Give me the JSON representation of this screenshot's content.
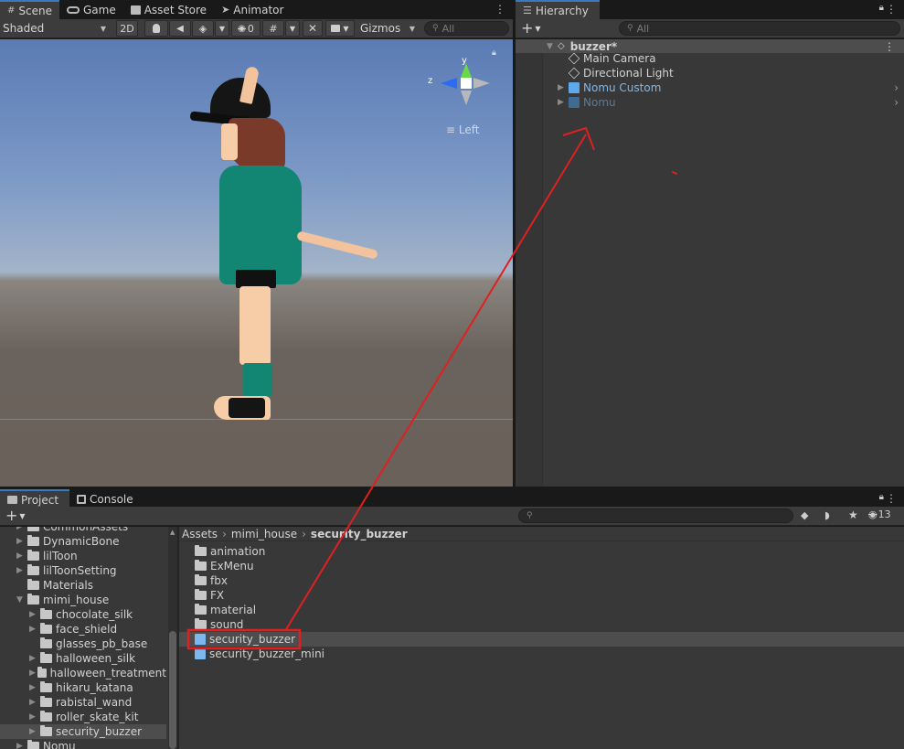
{
  "scene_tabs": [
    {
      "label": "Scene",
      "icon": "grid-icon"
    },
    {
      "label": "Game",
      "icon": "gamepad-icon"
    },
    {
      "label": "Asset Store",
      "icon": "store-icon"
    },
    {
      "label": "Animator",
      "icon": "animator-icon"
    }
  ],
  "scene_toolbar": {
    "shading_mode": "Shaded",
    "mode_2d": "2D",
    "hidden_count": "0",
    "gizmos_label": "Gizmos",
    "search_placeholder": "All"
  },
  "scene_view": {
    "gizmo_y": "y",
    "gizmo_z": "z",
    "view_label": "Left"
  },
  "hierarchy": {
    "tab_label": "Hierarchy",
    "search_placeholder": "All",
    "scene_name": "buzzer*",
    "items": [
      {
        "label": "Main Camera",
        "type": "object"
      },
      {
        "label": "Directional Light",
        "type": "object"
      },
      {
        "label": "Nomu Custom",
        "type": "prefab"
      },
      {
        "label": "Nomu",
        "type": "prefab-disabled"
      }
    ]
  },
  "project_tabs": [
    {
      "label": "Project",
      "icon": "folder-icon"
    },
    {
      "label": "Console",
      "icon": "console-icon"
    }
  ],
  "project_toolbar": {
    "hidden_count": "13"
  },
  "breadcrumb": [
    "Assets",
    "mimi_house",
    "security_buzzer"
  ],
  "folder_tree": [
    {
      "label": "CommonAssets",
      "indent": 0,
      "arrow": "right"
    },
    {
      "label": "DynamicBone",
      "indent": 0,
      "arrow": "right"
    },
    {
      "label": "lilToon",
      "indent": 0,
      "arrow": "right"
    },
    {
      "label": "lilToonSetting",
      "indent": 0,
      "arrow": "right"
    },
    {
      "label": "Materials",
      "indent": 0,
      "arrow": ""
    },
    {
      "label": "mimi_house",
      "indent": 0,
      "arrow": "down"
    },
    {
      "label": "chocolate_silk",
      "indent": 1,
      "arrow": "right"
    },
    {
      "label": "face_shield",
      "indent": 1,
      "arrow": "right"
    },
    {
      "label": "glasses_pb_base",
      "indent": 1,
      "arrow": ""
    },
    {
      "label": "halloween_silk",
      "indent": 1,
      "arrow": "right"
    },
    {
      "label": "halloween_treatment",
      "indent": 1,
      "arrow": "right"
    },
    {
      "label": "hikaru_katana",
      "indent": 1,
      "arrow": "right"
    },
    {
      "label": "rabistal_wand",
      "indent": 1,
      "arrow": "right"
    },
    {
      "label": "roller_skate_kit",
      "indent": 1,
      "arrow": "right"
    },
    {
      "label": "security_buzzer",
      "indent": 1,
      "arrow": "right",
      "selected": true
    },
    {
      "label": "Nomu",
      "indent": 0,
      "arrow": "right"
    }
  ],
  "asset_list": [
    {
      "label": "animation",
      "type": "folder"
    },
    {
      "label": "ExMenu",
      "type": "folder"
    },
    {
      "label": "fbx",
      "type": "folder"
    },
    {
      "label": "FX",
      "type": "folder"
    },
    {
      "label": "material",
      "type": "folder"
    },
    {
      "label": "sound",
      "type": "folder"
    },
    {
      "label": "security_buzzer",
      "type": "prefab",
      "highlighted": true
    },
    {
      "label": "security_buzzer_mini",
      "type": "prefab"
    }
  ],
  "colors": {
    "annotation_red": "#e02020",
    "prefab_blue": "#7bb8f0",
    "selection": "#4d4d4d",
    "tab_accent": "#3a79bb"
  }
}
